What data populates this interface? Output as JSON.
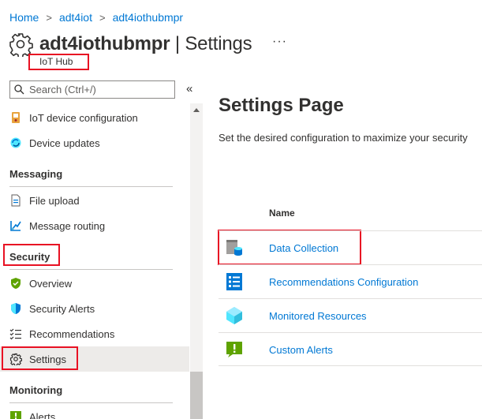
{
  "breadcrumb": [
    "Home",
    "adt4iot",
    "adt4iothubmpr"
  ],
  "header": {
    "resource_name": "adt4iothubmpr",
    "separator_page": " | Settings",
    "subtitle": "IoT Hub",
    "more": "···"
  },
  "search": {
    "placeholder": "Search (Ctrl+/)",
    "collapse": "«"
  },
  "sidebar": {
    "top_items": [
      {
        "label": "IoT device configuration",
        "icon": "device-configuration-icon"
      },
      {
        "label": "Device updates",
        "icon": "device-updates-icon"
      }
    ],
    "sections": [
      {
        "title": "Messaging",
        "items": [
          {
            "label": "File upload",
            "icon": "file-upload-icon"
          },
          {
            "label": "Message routing",
            "icon": "message-routing-icon"
          }
        ]
      },
      {
        "title": "Security",
        "items": [
          {
            "label": "Overview",
            "icon": "shield-icon"
          },
          {
            "label": "Security Alerts",
            "icon": "security-alert-icon"
          },
          {
            "label": "Recommendations",
            "icon": "recommendations-icon"
          },
          {
            "label": "Settings",
            "icon": "gear-icon"
          }
        ]
      },
      {
        "title": "Monitoring",
        "items": [
          {
            "label": "Alerts",
            "icon": "alerts-icon"
          }
        ]
      }
    ]
  },
  "main": {
    "title": "Settings Page",
    "description": "Set the desired configuration to maximize your security",
    "column_header": "Name",
    "rows": [
      {
        "label": "Data Collection",
        "icon": "data-collection-icon"
      },
      {
        "label": "Recommendations Configuration",
        "icon": "recommendations-configuration-icon"
      },
      {
        "label": "Monitored Resources",
        "icon": "monitored-resources-icon"
      },
      {
        "label": "Custom Alerts",
        "icon": "custom-alerts-icon"
      }
    ]
  },
  "colors": {
    "link": "#0078d4",
    "highlight_box": "#e81123",
    "selected_bg": "#edebe9"
  }
}
